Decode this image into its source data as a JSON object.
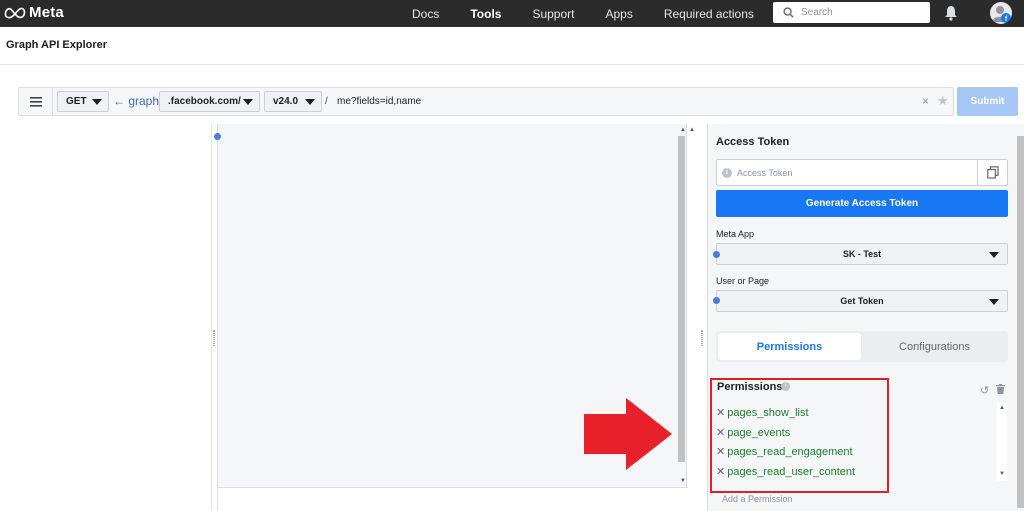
{
  "nav": {
    "logo": "Meta",
    "links": [
      {
        "label": "Docs",
        "bold": false
      },
      {
        "label": "Tools",
        "bold": true
      },
      {
        "label": "Support",
        "bold": false
      },
      {
        "label": "Apps",
        "bold": false
      },
      {
        "label": "Required actions",
        "bold": false
      }
    ],
    "search_placeholder": "Search",
    "icons": {
      "search": "search-icon",
      "notifications": "bell-icon",
      "profile": "avatar-icon"
    }
  },
  "page_title": "Graph API Explorer",
  "query": {
    "method": "GET",
    "graph_prefix": "← graph.",
    "domain": ".facebook.com/",
    "version": "v24.0",
    "separator": "/",
    "path": "me?fields=id,name",
    "clear": "×",
    "favorite": "★",
    "submit_label": "Submit"
  },
  "access": {
    "title": "Access Token",
    "token_placeholder": "Access Token",
    "generate_label": "Generate Access Token",
    "meta_app_label": "Meta App",
    "meta_app_value": "SK - Test",
    "user_page_label": "User or Page",
    "user_page_value": "Get Token",
    "tabs": [
      "Permissions",
      "Configurations"
    ],
    "active_tab": "Permissions"
  },
  "permissions": {
    "title": "Permissions",
    "items": [
      "pages_show_list",
      "page_events",
      "pages_read_engagement",
      "pages_read_user_content"
    ],
    "add_placeholder": "Add a Permission"
  },
  "colors": {
    "accent": "#1877f2",
    "highlight_box": "#e02027",
    "arrow": "#e8202a",
    "permission_text": "#1c7d2c"
  }
}
